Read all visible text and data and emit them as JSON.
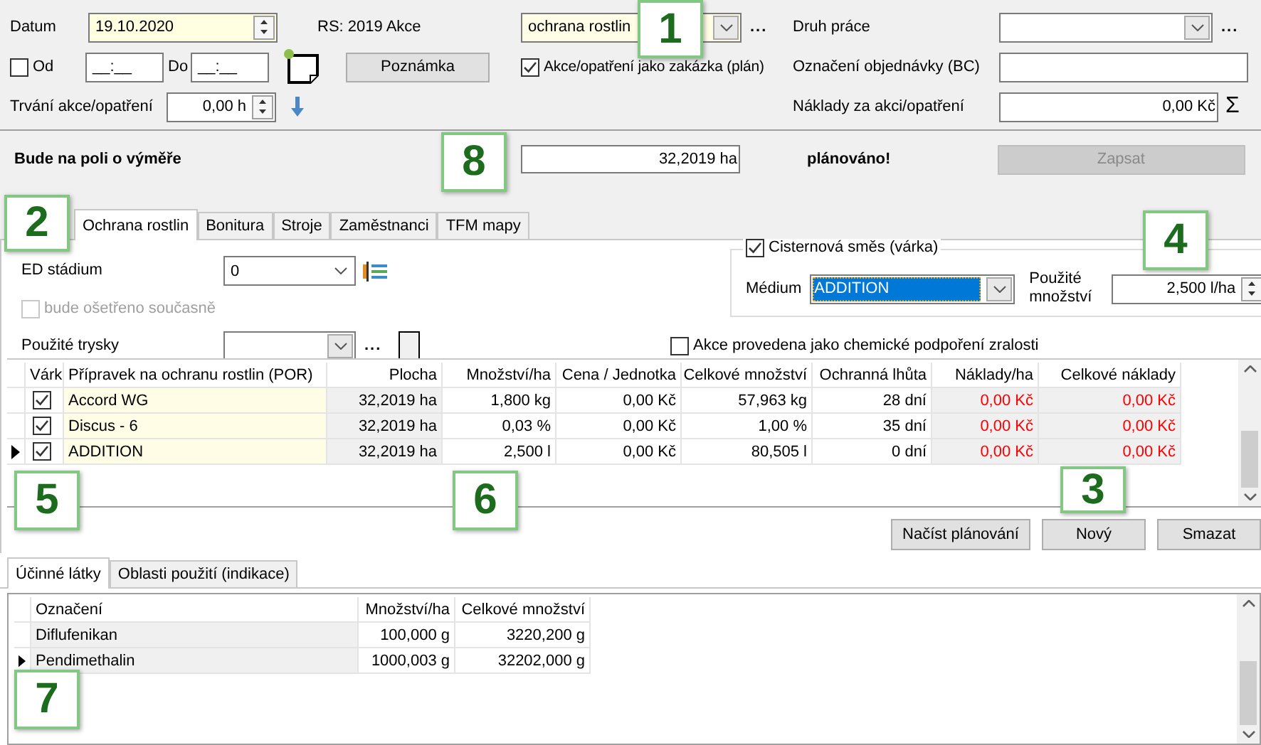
{
  "header": {
    "date": {
      "label": "Datum",
      "value": "19.10.2020"
    },
    "from": {
      "label": "Od",
      "checked": false,
      "value": "__:__"
    },
    "to": {
      "label": "Do",
      "value": "__:__"
    },
    "note_button": "Poznámka",
    "duration": {
      "label": "Trvání akce/opatření",
      "value": "0,00 h"
    },
    "rs_label": "RS: 2019 Akce",
    "action_type": {
      "value": "ochrana rostlin",
      "more": "..."
    },
    "as_order": {
      "label": "Akce/opatření jako zakázka (plán)",
      "checked": true
    },
    "work_type": {
      "label": "Druh práce",
      "more": "..."
    },
    "order_number": {
      "label": "Označení objednávky (BC)"
    },
    "costs": {
      "label": "Náklady za akci/opatření",
      "value": "0,00 Kč",
      "sum": "Σ"
    }
  },
  "area": {
    "label": "Bude na poli o výměře",
    "value": "32,2019 ha",
    "status": "plánováno!",
    "button": {
      "label": "Zapsat",
      "disabled": true
    }
  },
  "tabs": [
    {
      "label": "Ochrana rostlin",
      "selected": true
    },
    {
      "label": "Bonitura",
      "selected": false
    },
    {
      "label": "Stroje",
      "selected": false
    },
    {
      "label": "Zaměstnanci",
      "selected": false
    },
    {
      "label": "TFM mapy",
      "selected": false
    }
  ],
  "protection": {
    "ed_stage": {
      "label": "ED stádium",
      "value": "0"
    },
    "simultaneous": {
      "label": "bude ošetřeno současně",
      "checked": false,
      "disabled": true
    },
    "nozzles": {
      "label": "Použité trysky",
      "more": "..."
    },
    "mix": {
      "label": "Cisternová směs (várka)",
      "checked": true,
      "medium_label": "Médium",
      "medium": "ADDITION",
      "amount_label": "Použité množství",
      "amount": "2,500 l/ha"
    },
    "ripening": {
      "label": "Akce provedena jako chemické podpoření zralosti",
      "checked": false
    }
  },
  "products_table": {
    "batch_header": "Várk",
    "columns": [
      {
        "label": "Přípravek na ochranu rostlin (POR)",
        "kind": "name"
      },
      {
        "label": "Plocha",
        "kind": "computed"
      },
      {
        "label": "Množství/ha",
        "kind": "value"
      },
      {
        "label": "Cena / Jednotka",
        "kind": "value"
      },
      {
        "label": "Celkové množství",
        "kind": "value"
      },
      {
        "label": "Ochranná lhůta",
        "kind": "value"
      },
      {
        "label": "Náklady/ha",
        "kind": "cost"
      },
      {
        "label": "Celkové náklady",
        "kind": "cost"
      }
    ],
    "rows": [
      {
        "current": false,
        "batch": true,
        "cells": [
          "Accord WG",
          "32,2019 ha",
          "1,800 kg",
          "0,00 Kč",
          "57,963 kg",
          "28 dní",
          "0,00 Kč",
          "0,00 Kč"
        ]
      },
      {
        "current": false,
        "batch": true,
        "cells": [
          "Discus - 6",
          "32,2019 ha",
          "0,03 %",
          "0,00 Kč",
          "1,00 %",
          "35 dní",
          "0,00 Kč",
          "0,00 Kč"
        ]
      },
      {
        "current": true,
        "batch": true,
        "cells": [
          "ADDITION",
          "32,2019 ha",
          "2,500 l",
          "0,00 Kč",
          "80,505 l",
          "0 dní",
          "0,00 Kč",
          "0,00 Kč"
        ]
      }
    ]
  },
  "buttons": [
    "Načíst plánování",
    "Nový",
    "Smazat"
  ],
  "substance_tabs": [
    {
      "label": "Účinné látky",
      "selected": true
    },
    {
      "label": "Oblasti použití (indikace)",
      "selected": false
    }
  ],
  "substances_table": {
    "columns": [
      {
        "label": "Označení",
        "kind": "label"
      },
      {
        "label": "Množství/ha",
        "kind": "value"
      },
      {
        "label": "Celkové množství",
        "kind": "value"
      }
    ],
    "rows": [
      {
        "current": false,
        "cells": [
          "Diflufenikan",
          "100,000 g",
          "3220,200 g"
        ]
      },
      {
        "current": true,
        "cells": [
          "Pendimethalin",
          "1000,003 g",
          "32202,000 g"
        ]
      }
    ]
  },
  "callouts": [
    "1",
    "2",
    "3",
    "4",
    "5",
    "6",
    "7",
    "8"
  ]
}
